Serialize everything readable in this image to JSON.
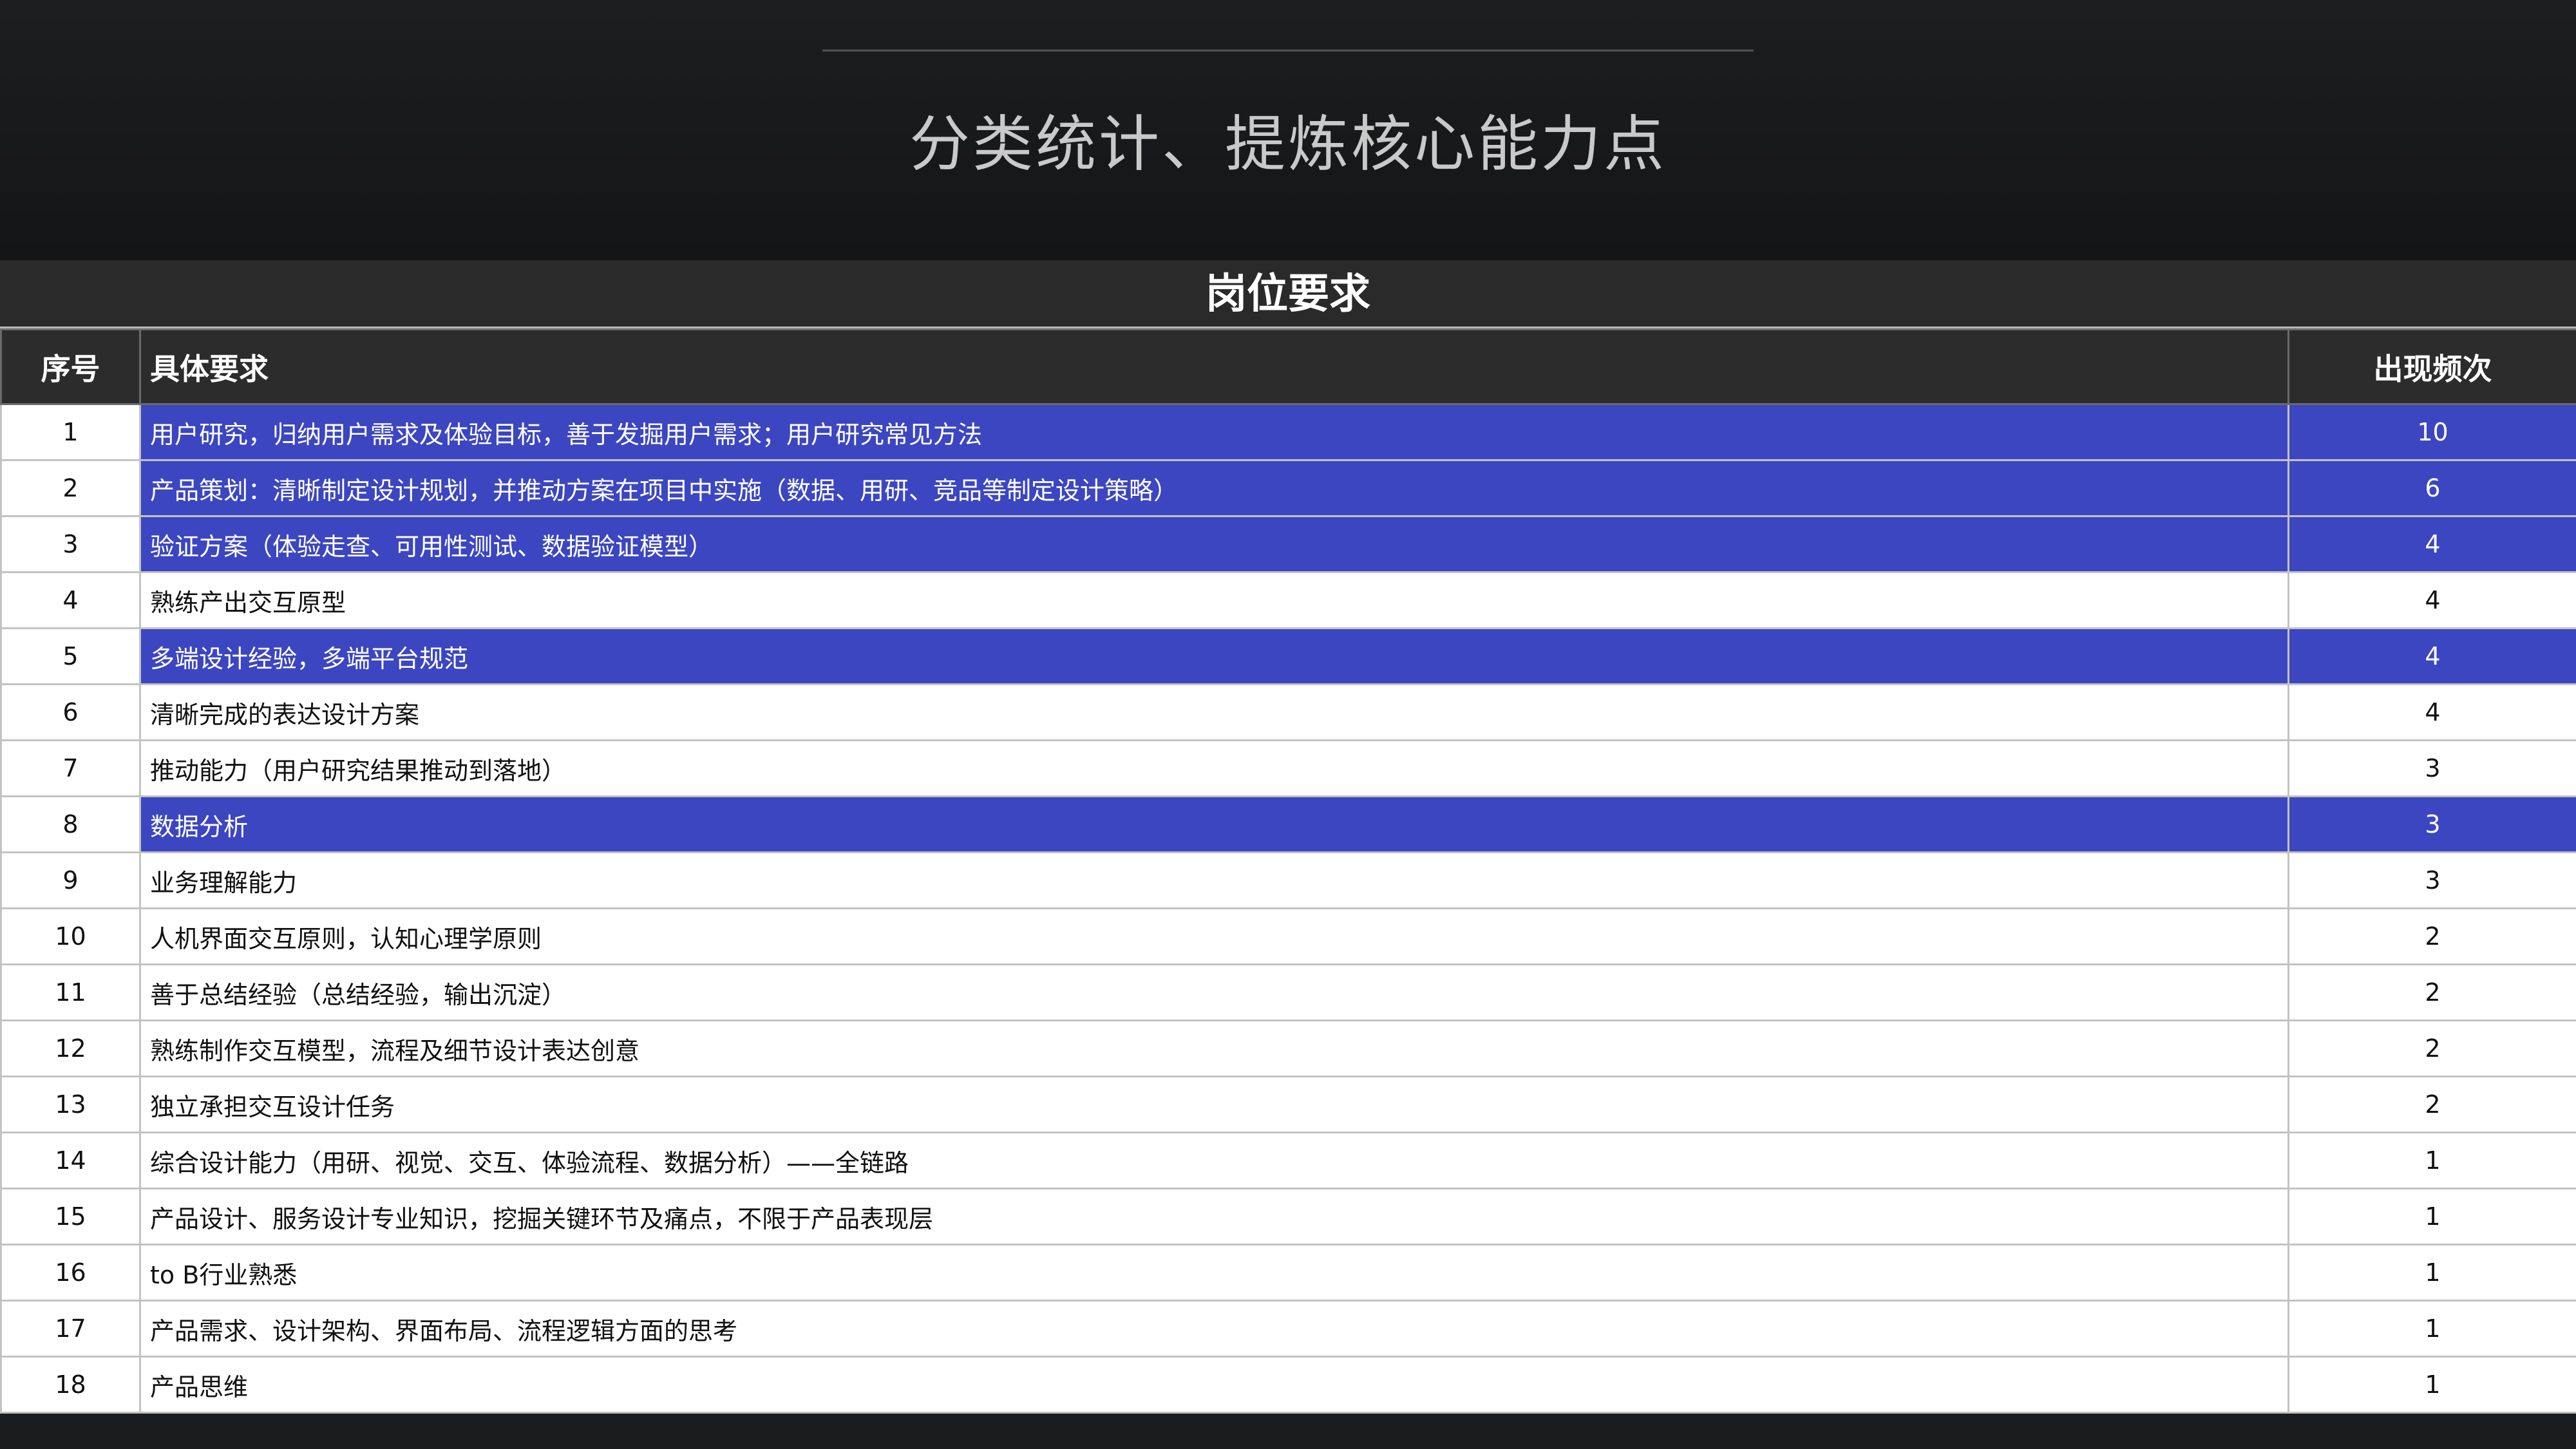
{
  "slide": {
    "title": "分类统计、提炼核心能力点"
  },
  "table": {
    "title": "岗位要求",
    "headers": {
      "seq": "序号",
      "requirement": "具体要求",
      "frequency": "出现频次"
    },
    "highlight_color": "#3c46c1",
    "rows": [
      {
        "seq": "1",
        "requirement": "用户研究，归纳用户需求及体验目标，善于发掘用户需求；用户研究常见方法",
        "frequency": "10",
        "highlighted": true
      },
      {
        "seq": "2",
        "requirement": "产品策划：清晰制定设计规划，并推动方案在项目中实施（数据、用研、竞品等制定设计策略）",
        "frequency": "6",
        "highlighted": true
      },
      {
        "seq": "3",
        "requirement": "验证方案（体验走查、可用性测试、数据验证模型）",
        "frequency": "4",
        "highlighted": true
      },
      {
        "seq": "4",
        "requirement": "熟练产出交互原型",
        "frequency": "4",
        "highlighted": false
      },
      {
        "seq": "5",
        "requirement": "多端设计经验，多端平台规范",
        "frequency": "4",
        "highlighted": true
      },
      {
        "seq": "6",
        "requirement": "清晰完成的表达设计方案",
        "frequency": "4",
        "highlighted": false
      },
      {
        "seq": "7",
        "requirement": "推动能力（用户研究结果推动到落地）",
        "frequency": "3",
        "highlighted": false
      },
      {
        "seq": "8",
        "requirement": "数据分析",
        "frequency": "3",
        "highlighted": true
      },
      {
        "seq": "9",
        "requirement": "业务理解能力",
        "frequency": "3",
        "highlighted": false
      },
      {
        "seq": "10",
        "requirement": "人机界面交互原则，认知心理学原则",
        "frequency": "2",
        "highlighted": false
      },
      {
        "seq": "11",
        "requirement": "善于总结经验（总结经验，输出沉淀）",
        "frequency": "2",
        "highlighted": false
      },
      {
        "seq": "12",
        "requirement": "熟练制作交互模型，流程及细节设计表达创意",
        "frequency": "2",
        "highlighted": false
      },
      {
        "seq": "13",
        "requirement": "独立承担交互设计任务",
        "frequency": "2",
        "highlighted": false
      },
      {
        "seq": "14",
        "requirement": "综合设计能力（用研、视觉、交互、体验流程、数据分析）——全链路",
        "frequency": "1",
        "highlighted": false
      },
      {
        "seq": "15",
        "requirement": "产品设计、服务设计专业知识，挖掘关键环节及痛点，不限于产品表现层",
        "frequency": "1",
        "highlighted": false
      },
      {
        "seq": "16",
        "requirement": "to B行业熟悉",
        "frequency": "1",
        "highlighted": false
      },
      {
        "seq": "17",
        "requirement": "产品需求、设计架构、界面布局、流程逻辑方面的思考",
        "frequency": "1",
        "highlighted": false
      },
      {
        "seq": "18",
        "requirement": "产品思维",
        "frequency": "1",
        "highlighted": false
      }
    ]
  }
}
